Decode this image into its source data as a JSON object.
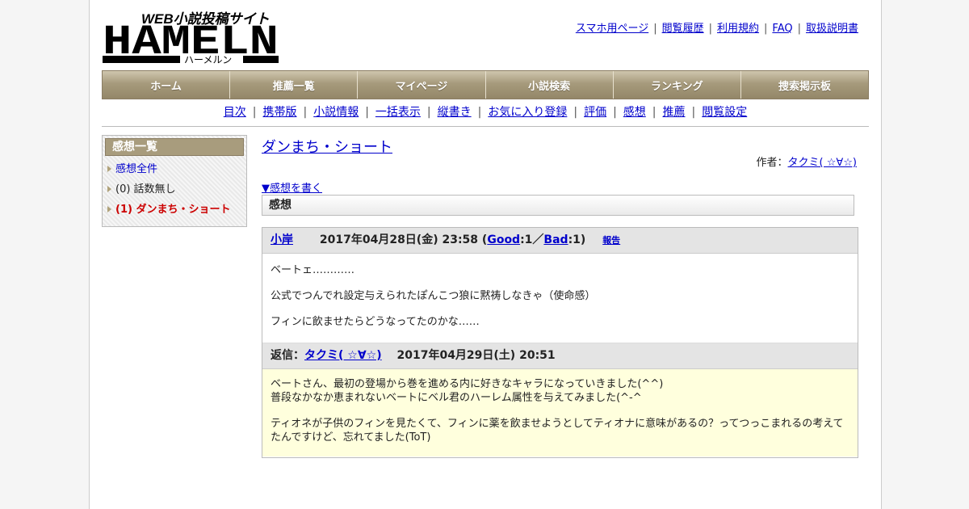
{
  "header": {
    "logo_text": "HAMELN",
    "logo_tagline": "WEB小説投稿サイト",
    "logo_kana": "ハーメルン",
    "links": [
      "スマホ用ページ",
      "閲覧履歴",
      "利用規約",
      "FAQ",
      "取扱説明書"
    ]
  },
  "main_nav": [
    "ホーム",
    "推薦一覧",
    "マイページ",
    "小説検索",
    "ランキング",
    "捜索掲示板"
  ],
  "sub_nav": [
    "目次",
    "携帯版",
    "小説情報",
    "一括表示",
    "縦書き",
    "お気に入り登録",
    "評価",
    "感想",
    "推薦",
    "閲覧設定"
  ],
  "sidebar": {
    "title": "感想一覧",
    "items": [
      {
        "label": "感想全件"
      },
      {
        "label": "(0) 話数無し"
      },
      {
        "label": "(1) ダンまち・ショート"
      }
    ]
  },
  "novel": {
    "title": "ダンまち・ショート",
    "author_label": "作者：",
    "author_name": "タクミ( ☆∀☆)",
    "write_link": "▼感想を書く",
    "section_label": "感想"
  },
  "review": {
    "user": "小岸",
    "date": "2017年04月28日(金) 23:58",
    "good_label": "Good",
    "good_count": ":1／",
    "bad_label": "Bad",
    "bad_count": ":1)",
    "open_paren": "(",
    "report": "報告",
    "body": [
      "ベートェ…………",
      "公式でつんでれ設定与えられたぽんこつ狼に黙祷しなきゃ（使命感）",
      "フィンに飲ませたらどうなってたのかな……"
    ]
  },
  "reply": {
    "label": "返信：",
    "user": "タクミ( ☆∀☆)",
    "date": "2017年04月29日(土) 20:51",
    "body": [
      "ベートさん、最初の登場から巻を進める内に好きなキャラになっていきました(^^)",
      "普段なかなか恵まれないベートにベル君のハーレム属性を与えてみました(^-^",
      "ティオネが子供のフィンを見たくて、フィンに薬を飲ませようとしてティオナに意味があるの？ってつっこまれるの考えてたんですけど、忘れてました(ToT)"
    ]
  }
}
